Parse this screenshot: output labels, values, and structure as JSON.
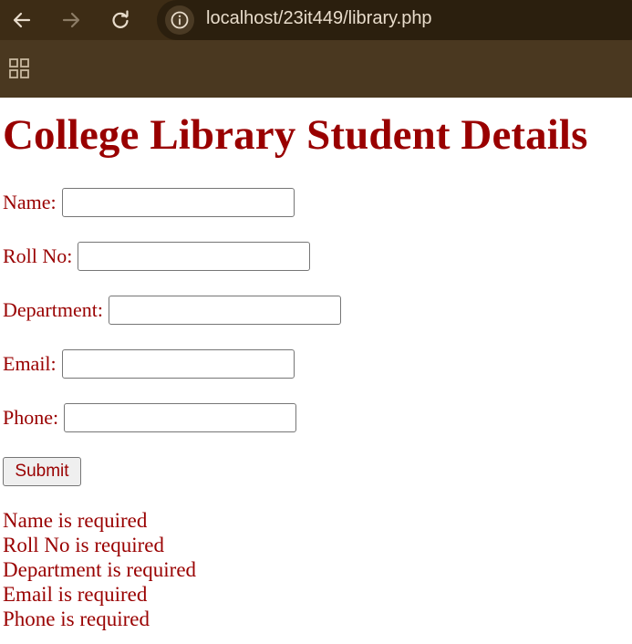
{
  "browser": {
    "url": "localhost/23it449/library.php"
  },
  "page": {
    "title": "College Library Student Details",
    "fields": [
      {
        "label": "Name:",
        "value": ""
      },
      {
        "label": "Roll No:",
        "value": ""
      },
      {
        "label": "Department:",
        "value": ""
      },
      {
        "label": "Email:",
        "value": ""
      },
      {
        "label": "Phone:",
        "value": ""
      }
    ],
    "submit_label": "Submit",
    "errors": [
      "Name is required",
      "Roll No is required",
      "Department is required",
      "Email is required",
      "Phone is required"
    ]
  },
  "colors": {
    "text": "#990000",
    "chrome": "#4a3820"
  }
}
